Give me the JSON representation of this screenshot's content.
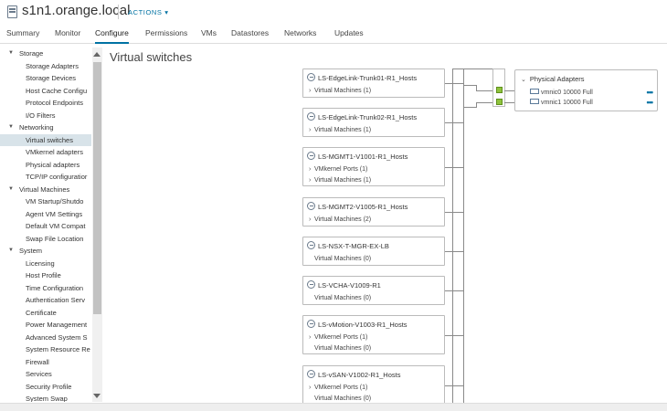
{
  "header": {
    "title": "s1n1.orange.local",
    "actions_label": "ACTIONS ▾",
    "tabs": [
      {
        "label": "Summary"
      },
      {
        "label": "Monitor"
      },
      {
        "label": "Configure"
      },
      {
        "label": "Permissions"
      },
      {
        "label": "VMs"
      },
      {
        "label": "Datastores"
      },
      {
        "label": "Networks"
      },
      {
        "label": "Updates"
      }
    ]
  },
  "sidebar": {
    "items": [
      {
        "label": "Storage",
        "group": true
      },
      {
        "label": "Storage Adapters"
      },
      {
        "label": "Storage Devices"
      },
      {
        "label": "Host Cache Configu"
      },
      {
        "label": "Protocol Endpoints"
      },
      {
        "label": "I/O Filters"
      },
      {
        "label": "Networking",
        "group": true
      },
      {
        "label": "Virtual switches",
        "selected": true
      },
      {
        "label": "VMkernel adapters"
      },
      {
        "label": "Physical adapters"
      },
      {
        "label": "TCP/IP configuratior"
      },
      {
        "label": "Virtual Machines",
        "group": true
      },
      {
        "label": "VM Startup/Shutdo"
      },
      {
        "label": "Agent VM Settings"
      },
      {
        "label": "Default VM Compat"
      },
      {
        "label": "Swap File Location"
      },
      {
        "label": "System",
        "group": true
      },
      {
        "label": "Licensing"
      },
      {
        "label": "Host Profile"
      },
      {
        "label": "Time Configuration"
      },
      {
        "label": "Authentication Serv"
      },
      {
        "label": "Certificate"
      },
      {
        "label": "Power Management"
      },
      {
        "label": "Advanced System S"
      },
      {
        "label": "System Resource Re"
      },
      {
        "label": "Firewall"
      },
      {
        "label": "Services"
      },
      {
        "label": "Security Profile"
      },
      {
        "label": "System Swap"
      }
    ]
  },
  "main": {
    "title": "Virtual switches",
    "switches": [
      {
        "name": "LS-EdgeLink-Trunk01-R1_Hosts",
        "rows": [
          {
            "label": "Virtual Machines (1)",
            "expandable": true
          }
        ]
      },
      {
        "name": "LS-EdgeLink-Trunk02-R1_Hosts",
        "rows": [
          {
            "label": "Virtual Machines (1)",
            "expandable": true
          }
        ]
      },
      {
        "name": "LS-MGMT1-V1001-R1_Hosts",
        "rows": [
          {
            "label": "VMkernel Ports (1)",
            "expandable": true
          },
          {
            "label": "Virtual Machines (1)",
            "expandable": true
          }
        ]
      },
      {
        "name": "LS-MGMT2-V1005-R1_Hosts",
        "rows": [
          {
            "label": "Virtual Machines (2)",
            "expandable": true
          }
        ]
      },
      {
        "name": "LS-NSX-T-MGR-EX-LB",
        "rows": [
          {
            "label": "Virtual Machines (0)",
            "expandable": false
          }
        ]
      },
      {
        "name": "LS-VCHA-V1009-R1",
        "rows": [
          {
            "label": "Virtual Machines (0)",
            "expandable": false
          }
        ]
      },
      {
        "name": "LS-vMotion-V1003-R1_Hosts",
        "rows": [
          {
            "label": "VMkernel Ports (1)",
            "expandable": true
          },
          {
            "label": "Virtual Machines (0)",
            "expandable": false
          }
        ]
      },
      {
        "name": "LS-vSAN-V1002-R1_Hosts",
        "rows": [
          {
            "label": "VMkernel Ports (1)",
            "expandable": true
          },
          {
            "label": "Virtual Machines (0)",
            "expandable": false
          }
        ]
      }
    ],
    "physical_adapters": {
      "title": "Physical Adapters",
      "items": [
        {
          "label": "vmnic0 10000 Full",
          "menu": "•••"
        },
        {
          "label": "vmnic1 10000 Full",
          "menu": "•••"
        }
      ]
    }
  },
  "colors": {
    "accent": "#0072a3",
    "selected_bg": "#d8e3e9",
    "port_green": "#8fc33c"
  }
}
